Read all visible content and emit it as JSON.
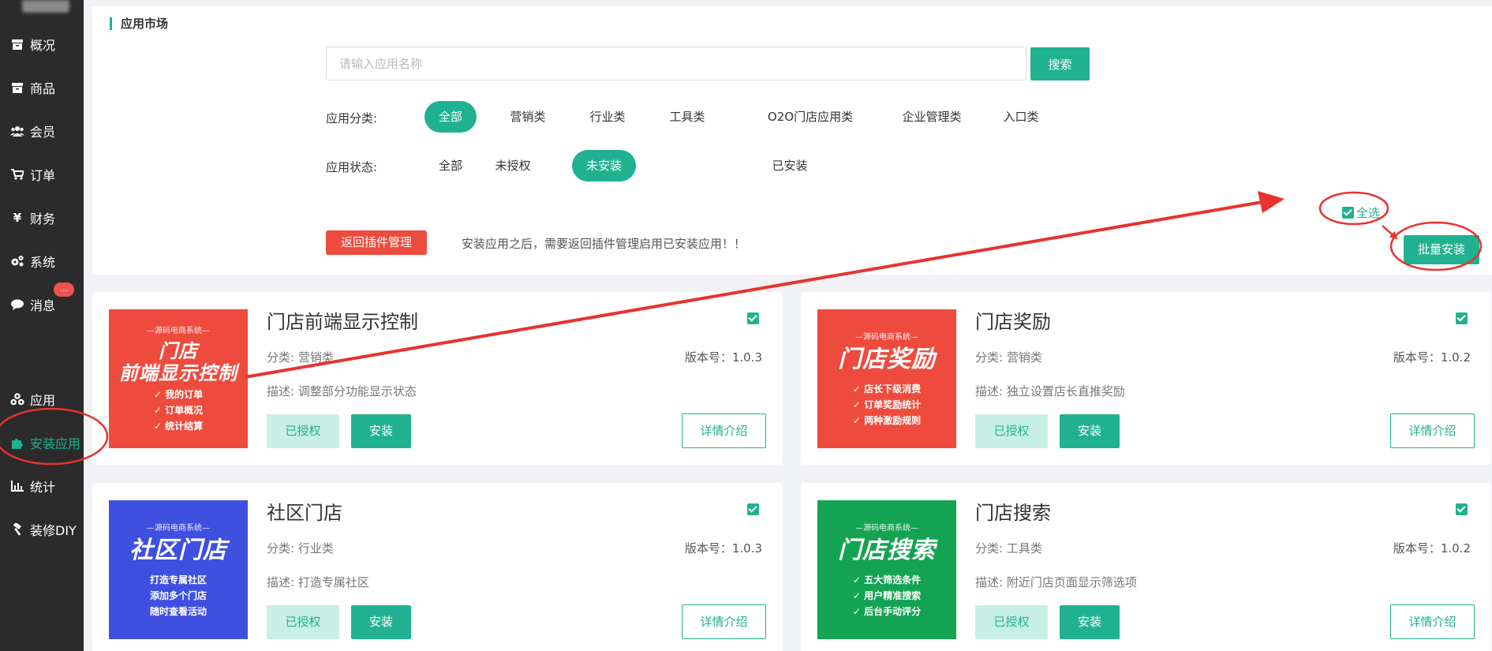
{
  "sidebar": {
    "items": [
      {
        "label": "概况",
        "icon": "box-icon"
      },
      {
        "label": "商品",
        "icon": "box-icon"
      },
      {
        "label": "会员",
        "icon": "users-icon"
      },
      {
        "label": "订单",
        "icon": "cart-icon"
      },
      {
        "label": "财务",
        "icon": "yen-icon"
      },
      {
        "label": "系统",
        "icon": "gears-icon"
      },
      {
        "label": "消息",
        "icon": "chat-icon",
        "badge": "..."
      },
      {
        "label": "应用",
        "icon": "cubes-icon"
      },
      {
        "label": "安装应用",
        "icon": "puzzle-icon",
        "active": true
      },
      {
        "label": "统计",
        "icon": "bar-chart-icon"
      },
      {
        "label": "装修DIY",
        "icon": "hammer-icon"
      }
    ]
  },
  "panel": {
    "title": "应用市场",
    "search_placeholder": "请输入应用名称",
    "search_button": "搜索",
    "category_label": "应用分类:",
    "categories": [
      "全部",
      "营销类",
      "行业类",
      "工具类",
      "O2O门店应用类",
      "企业管理类",
      "入口类"
    ],
    "status_label": "应用状态:",
    "statuses": [
      "全部",
      "未授权",
      "未安装",
      "已安装"
    ],
    "back_button": "返回插件管理",
    "notice": "安装应用之后，需要返回插件管理启用已安装应用！！",
    "select_all": "全选",
    "batch_install": "批量安装"
  },
  "cards": [
    {
      "title": "门店前端显示控制",
      "category": "分类: 营销类",
      "version": "版本号：1.0.3",
      "desc": "描述: 调整部分功能显示状态",
      "img_tag": "—源码电商系统—",
      "img_title": "门店\n前端显示控制",
      "img_features": [
        "✓ 我的订单",
        "✓ 订单概况",
        "✓ 统计结算"
      ],
      "auth": "已授权",
      "install": "安装",
      "detail": "详情介绍"
    },
    {
      "title": "门店奖励",
      "category": "分类: 营销类",
      "version": "版本号：1.0.2",
      "desc": "描述: 独立设置店长直推奖励",
      "img_tag": "—源码电商系统—",
      "img_title": "门店奖励",
      "img_features": [
        "✓ 店长下级消费",
        "✓ 订单奖励统计",
        "✓ 两种激励规则"
      ],
      "auth": "已授权",
      "install": "安装",
      "detail": "详情介绍"
    },
    {
      "title": "社区门店",
      "category": "分类: 行业类",
      "version": "版本号：1.0.3",
      "desc": "描述: 打造专属社区",
      "img_tag": "—源码电商系统—",
      "img_title": "社区门店",
      "img_features": [
        "打造专属社区",
        "添加多个门店",
        "随时查看活动"
      ],
      "auth": "已授权",
      "install": "安装",
      "detail": "详情介绍"
    },
    {
      "title": "门店搜索",
      "category": "分类: 工具类",
      "version": "版本号：1.0.2",
      "desc": "描述: 附近门店页面显示筛选项",
      "img_tag": "—源码电商系统—",
      "img_title": "门店搜索",
      "img_features": [
        "✓ 五大筛选条件",
        "✓ 用户精准搜索",
        "✓ 后台手动评分"
      ],
      "auth": "已授权",
      "install": "安装",
      "detail": "详情介绍"
    }
  ],
  "colors": {
    "accent": "#20b290",
    "danger": "#ee4b3e",
    "sidebar_bg": "#2b2b2b",
    "annotation": "#e8322f",
    "card_img_red": "#ee4b3e",
    "card_img_blue": "#3f4fe0",
    "card_img_green": "#14a352"
  }
}
